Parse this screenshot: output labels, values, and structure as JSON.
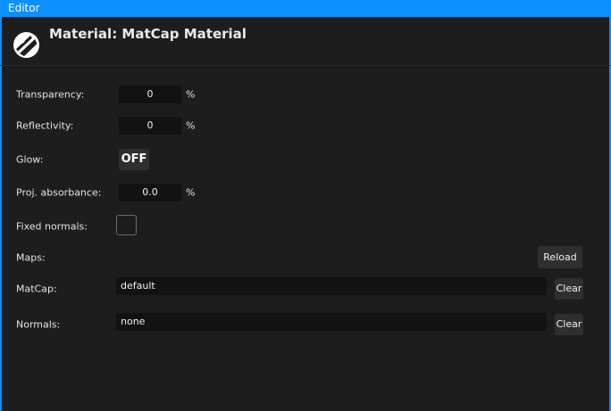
{
  "window": {
    "title": "Editor",
    "accent": "#0c8fff"
  },
  "header": {
    "title": "Material: MatCap Material",
    "logo_icon": "material-sphere-icon"
  },
  "fields": {
    "transparency": {
      "label": "Transparency:",
      "value": "0",
      "unit": "%"
    },
    "reflectivity": {
      "label": "Reflectivity:",
      "value": "0",
      "unit": "%"
    },
    "glow": {
      "label": "Glow:",
      "value": "OFF"
    },
    "proj_absorbance": {
      "label": "Proj. absorbance:",
      "value": "0.0",
      "unit": "%"
    },
    "fixed_normals": {
      "label": "Fixed normals:",
      "checked": false
    }
  },
  "maps": {
    "label": "Maps:",
    "reload_label": "Reload",
    "matcap": {
      "label": "MatCap:",
      "value": "default",
      "clear_label": "Clear"
    },
    "normals": {
      "label": "Normals:",
      "value": "none",
      "clear_label": "Clear"
    }
  }
}
